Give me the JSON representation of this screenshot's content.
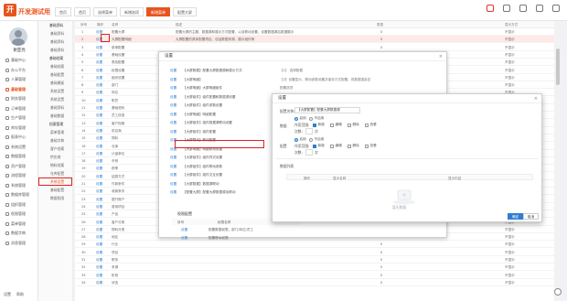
{
  "app": {
    "brand": "开发测试用",
    "logo_glyph": "开"
  },
  "tabs": [
    "首页",
    "首页",
    "选择菜单",
    "新增选项",
    "新增菜单",
    "配置大屏"
  ],
  "tabs_active_index": 4,
  "user": {
    "name": "谢亚亮"
  },
  "nav": [
    "基础中心",
    "办公平台",
    "人事管理",
    "基础管理",
    "财务管理",
    "订单管理",
    "生产管理",
    "库存管理",
    "报表中心",
    "系统设置",
    "数据管理",
    "资产管理",
    "流程管理",
    "系统管理",
    "数据库管理",
    "组织管理",
    "权限管理",
    "菜单管理",
    "数据字典",
    "消息管理"
  ],
  "nav_active_index": 3,
  "sidebar_bottom": [
    "设置",
    "帮助"
  ],
  "submenu": [
    {
      "t": "基础资料",
      "hd": true
    },
    {
      "t": "基础资料"
    },
    {
      "t": "基础资料"
    },
    {
      "t": "基础资料"
    },
    {
      "t": "基础档案",
      "hd": true
    },
    {
      "t": "基础档案"
    },
    {
      "t": "基础配置"
    },
    {
      "t": "基础模板"
    },
    {
      "t": "系统设置"
    },
    {
      "t": "系统设置"
    },
    {
      "t": "基础资料"
    },
    {
      "t": "基础数据"
    },
    {
      "t": "档案管理",
      "hd": true
    },
    {
      "t": "菜单管理"
    },
    {
      "t": "基础字典"
    },
    {
      "t": "客户档案"
    },
    {
      "t": "供应商"
    },
    {
      "t": "物料档案"
    },
    {
      "t": "仓库配置"
    },
    {
      "t": "系统设置",
      "sel": true
    },
    {
      "t": "基础配置"
    },
    {
      "t": "数据权限"
    }
  ],
  "submenu_selected_index": 19,
  "table": {
    "headers": [
      "序号",
      "操作",
      "名称",
      "描述",
      "",
      "类型",
      "显示方式"
    ],
    "rows": [
      {
        "op": "设置",
        "name": "配置大屏",
        "desc": "配置大屏的主题、数据源和展示方式配置，以及联动设置，设置数据源后数据展示",
        "type": "0",
        "mode": "不显示"
      },
      {
        "op": "设置",
        "name": "大屏配置明细",
        "desc": "大屏配置的具体配置项目，包括数据来源、展示组件等",
        "type": "0",
        "mode": "不显示",
        "hl": true
      },
      {
        "op": "设置",
        "name": "菜单配置",
        "desc": "",
        "type": "0",
        "mode": "不显示"
      },
      {
        "op": "设置",
        "name": "基础设置",
        "desc": "",
        "type": "0",
        "mode": "不显示"
      },
      {
        "op": "设置",
        "name": "角色配置",
        "desc": "",
        "type": "0",
        "mode": "不显示"
      },
      {
        "op": "设置",
        "name": "权限设置",
        "desc": "",
        "type": "0",
        "mode": "不显示"
      },
      {
        "op": "设置",
        "name": "组织设置",
        "desc": "",
        "type": "0",
        "mode": "不显示"
      },
      {
        "op": "设置",
        "name": "部门",
        "desc": "",
        "type": "0",
        "mode": "不显示"
      },
      {
        "op": "设置",
        "name": "岗位",
        "desc": "",
        "type": "0",
        "mode": "不显示"
      },
      {
        "op": "设置",
        "name": "职员",
        "desc": "",
        "type": "0",
        "mode": "不显示"
      },
      {
        "op": "设置",
        "name": "基础资料",
        "desc": "",
        "type": "0",
        "mode": "不显示"
      },
      {
        "op": "设置",
        "name": "员工信息",
        "desc": "",
        "type": "0",
        "mode": "不显示"
      },
      {
        "op": "设置",
        "name": "客户档案",
        "desc": "",
        "type": "0",
        "mode": "不显示"
      },
      {
        "op": "设置",
        "name": "供应商",
        "desc": "",
        "type": "0",
        "mode": "不显示"
      },
      {
        "op": "设置",
        "name": "物料",
        "desc": "",
        "type": "0",
        "mode": "不显示"
      },
      {
        "op": "设置",
        "name": "仓库",
        "desc": "",
        "type": "0",
        "mode": "不显示"
      },
      {
        "op": "设置",
        "name": "计量单位",
        "desc": "",
        "type": "0",
        "mode": "不显示"
      },
      {
        "op": "设置",
        "name": "币别",
        "desc": "",
        "type": "0",
        "mode": "不显示"
      },
      {
        "op": "设置",
        "name": "税率",
        "desc": "",
        "type": "0",
        "mode": "不显示"
      },
      {
        "op": "设置",
        "name": "结算方式",
        "desc": "",
        "type": "0",
        "mode": "不显示"
      },
      {
        "op": "设置",
        "name": "付款条件",
        "desc": "",
        "type": "0",
        "mode": "不显示"
      },
      {
        "op": "设置",
        "name": "收款条件",
        "desc": "",
        "type": "0",
        "mode": "不显示"
      },
      {
        "op": "设置",
        "name": "银行账户",
        "desc": "",
        "type": "0",
        "mode": "不显示"
      },
      {
        "op": "设置",
        "name": "费用项目",
        "desc": "",
        "type": "0",
        "mode": "不显示"
      },
      {
        "op": "设置",
        "name": "产品",
        "desc": "",
        "type": "0",
        "mode": "不显示"
      },
      {
        "op": "设置",
        "name": "客户分类",
        "desc": "",
        "type": "0",
        "mode": "不显示"
      },
      {
        "op": "设置",
        "name": "物料分类",
        "desc": "",
        "type": "0",
        "mode": "不显示"
      },
      {
        "op": "设置",
        "name": "地区",
        "desc": "",
        "type": "0",
        "mode": "不显示"
      },
      {
        "op": "设置",
        "name": "行业",
        "desc": "",
        "type": "0",
        "mode": "不显示"
      },
      {
        "op": "设置",
        "name": "项目",
        "desc": "",
        "type": "0",
        "mode": "不显示"
      },
      {
        "op": "设置",
        "name": "职务",
        "desc": "",
        "type": "0",
        "mode": "不显示"
      },
      {
        "op": "设置",
        "name": "来源",
        "desc": "",
        "type": "0",
        "mode": "不显示"
      },
      {
        "op": "设置",
        "name": "阶段",
        "desc": "",
        "type": "0",
        "mode": "不显示"
      },
      {
        "op": "设置",
        "name": "状态",
        "desc": "",
        "type": "0",
        "mode": "不显示"
      }
    ]
  },
  "dialog1": {
    "title": "设置",
    "close": "×",
    "rows": [
      {
        "op": "设置",
        "text": "【大屏数据】配置大屏数据源和展示方式",
        "right": "【1】 选择数据"
      },
      {
        "op": "设置",
        "text": "【大屏明细】",
        "right": "【2】设置显示、联动参数设置并保存方式配置，将数据渲染至"
      },
      {
        "op": "设置",
        "text": "【大屏明细】大屏明细组件",
        "right": "配置选项"
      },
      {
        "op": "设置",
        "text": "【大屏组件】组件配置和数据源设置",
        "right": ""
      },
      {
        "op": "设置",
        "text": "【大屏组件】组件参数设置",
        "right": ""
      },
      {
        "op": "设置",
        "text": "【大屏明细】明细配置",
        "right": ""
      },
      {
        "op": "设置",
        "text": "【大屏组件】组件数据源联动设置",
        "right": ""
      },
      {
        "op": "设置",
        "text": "【大屏组件】组件配置",
        "right": ""
      },
      {
        "op": "设置",
        "text": "【大屏联动】联动配置",
        "right": ""
      },
      {
        "op": "设置",
        "text": "【大屏明细】明细联动设置",
        "right": ""
      },
      {
        "op": "设置",
        "text": "【大屏组件】组件样式设置",
        "right": ""
      },
      {
        "op": "设置",
        "text": "【大屏组件】组件联动参数",
        "right": ""
      },
      {
        "op": "设置",
        "text": "【大屏组件】组件交互设置",
        "right": ""
      },
      {
        "op": "设置",
        "text": "【大屏数据】数据源联动",
        "right": ""
      },
      {
        "op": "设置",
        "text": "【配置大屏】配置大屏数据源及联动",
        "right": ""
      }
    ],
    "section_title": "权限配置",
    "bottom_headers": [
      "序号",
      "权限名称"
    ],
    "bottom_rows": [
      {
        "op": "设置",
        "text": "配置数据权限，部门/岗位/员工"
      },
      {
        "op": "设置",
        "text": "配置联动权限"
      },
      {
        "op": "设置",
        "text": "配置组件权限"
      },
      {
        "op": "设置",
        "text": "JP-组件数据源权限配置"
      }
    ]
  },
  "dialog2": {
    "title": "设置",
    "close": "×",
    "name_label": "配置名称:",
    "name_value": "【大屏配置】配置大屏数据源",
    "group1_label": "数据",
    "group2_label": "配置",
    "radio_a": "启用",
    "radio_b": "不启用",
    "scope_label": "作用范围:",
    "scope_opts": [
      "新增",
      "编辑",
      "删除",
      "查看"
    ],
    "count_label": "次数:",
    "count_suffix": "次",
    "list_title": "数据列表",
    "list_headers": [
      "操作",
      "显示名称",
      "显示内容"
    ],
    "empty_text": "暂无数据",
    "btn_ok": "确定",
    "btn_cancel": "取消"
  },
  "colors": {
    "accent": "#e8541e",
    "link": "#2f7fd0",
    "highlight": "#e02020"
  }
}
